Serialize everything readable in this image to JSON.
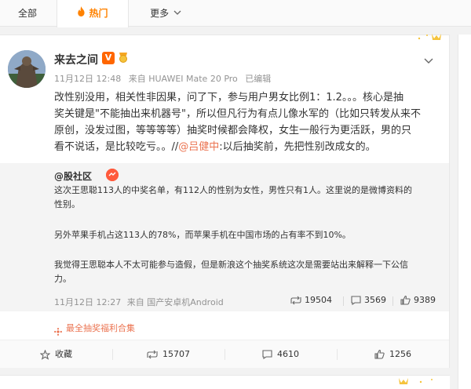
{
  "tabs": {
    "all": "全部",
    "hot": "热门",
    "more": "更多"
  },
  "post": {
    "username": "来去之间",
    "vip_label": "V",
    "timestamp": "11月12日 12:48",
    "source": "来自 HUAWEI Mate 20 Pro",
    "edited": "已编辑",
    "text_lines": [
      "改性别没用，相关性非因果，问了下，参与用户男女比例1：1.2。。。核心是抽",
      "奖关键是\"不能抽出来机器号\"，所以但凡行为有点儿像水军的（比如只转发从来不",
      "原创，没发过图，等等等等）抽奖时候都会降权，女生一般行为更活跃，男的只",
      "看不说话，是比较吃亏。。//"
    ],
    "mention": "@吕健中",
    "mention_tail": ":以后抽奖前，先把性别改成女的。"
  },
  "retweet": {
    "username": "@股社区",
    "lines": [
      "这次王思聪113人的中奖名单，有112人的性别为女性，男性只有1人。这里说的是微博资料的",
      "性别。",
      "另外苹果手机占这113人的78%，而苹果手机在中国市场的占有率不到10%。",
      "我觉得王思聪本人不太可能参与造假，但是新浪这个抽奖系统这次是需要站出来解释一下公信",
      "力。"
    ],
    "timestamp": "11月12日 12:27",
    "source": "来自 国产安卓机Android",
    "reposts": "19504",
    "comments": "3569",
    "likes": "9389"
  },
  "collection": "最全抽奖福利合集",
  "actions": {
    "favorite": "收藏",
    "repost": "15707",
    "comment": "4610",
    "like": "1256"
  },
  "colors": {
    "accent": "#ff8200",
    "link": "#eb7350",
    "meta": "#939393"
  }
}
